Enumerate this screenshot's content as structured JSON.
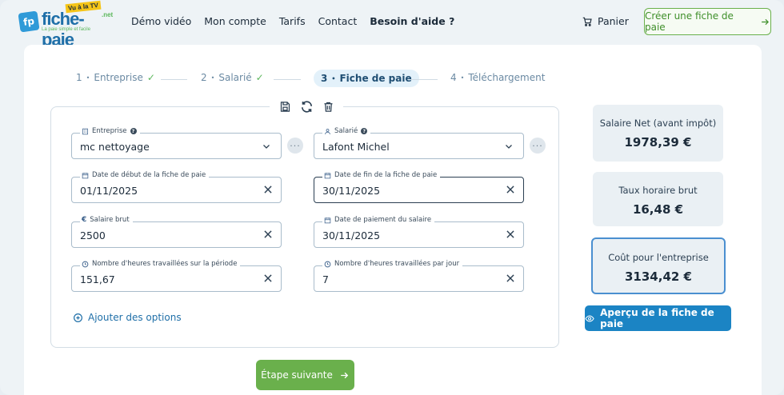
{
  "header": {
    "logo": {
      "badge": "fp",
      "name": "fiche-paie",
      "tv": "Vu à la TV",
      "net": ".net",
      "tagline": "La paie simple et facile"
    },
    "nav": [
      {
        "label": "Démo vidéo",
        "bold": false
      },
      {
        "label": "Mon compte",
        "bold": false
      },
      {
        "label": "Tarifs",
        "bold": false
      },
      {
        "label": "Contact",
        "bold": false
      },
      {
        "label": "Besoin d'aide ?",
        "bold": true
      }
    ],
    "cart_label": "Panier",
    "cta_label": "Créer une fiche de paie"
  },
  "stepper": [
    {
      "num": "1",
      "label": "Entreprise",
      "done": true
    },
    {
      "num": "2",
      "label": "Salarié",
      "done": true
    },
    {
      "num": "3",
      "label": "Fiche de paie",
      "active": true
    },
    {
      "num": "4",
      "label": "Téléchargement"
    }
  ],
  "form": {
    "entreprise": {
      "label": "Entreprise",
      "value": "mc nettoyage"
    },
    "salarie": {
      "label": "Salarié",
      "value": "Lafont Michel"
    },
    "date_debut": {
      "label": "Date de début de la fiche de paie",
      "value": "01/11/2025"
    },
    "date_fin": {
      "label": "Date de fin de la fiche de paie",
      "value": "30/11/2025"
    },
    "salaire_brut": {
      "label": "Salaire brut",
      "value": "2500"
    },
    "date_paiement": {
      "label": "Date de paiement du salaire",
      "value": "30/11/2025"
    },
    "heures_periode": {
      "label": "Nombre d'heures travaillées sur la période",
      "value": "151,67"
    },
    "heures_jour": {
      "label": "Nombre d'heures travaillées par jour",
      "value": "7"
    },
    "add_options": "Ajouter des options",
    "next_label": "Étape suivante",
    "more_glyph": "···"
  },
  "summary": {
    "net": {
      "title": "Salaire Net (avant impôt)",
      "value": "1978,39 €"
    },
    "taux": {
      "title": "Taux horaire brut",
      "value": "16,48 €"
    },
    "cout": {
      "title": "Coût pour l'entreprise",
      "value": "3134,42 €"
    },
    "preview_label": "Aperçu de la fiche de paie"
  },
  "colors": {
    "green": "#6ab04c",
    "blue": "#1b84c4",
    "accent_border": "#4a8fd0"
  }
}
